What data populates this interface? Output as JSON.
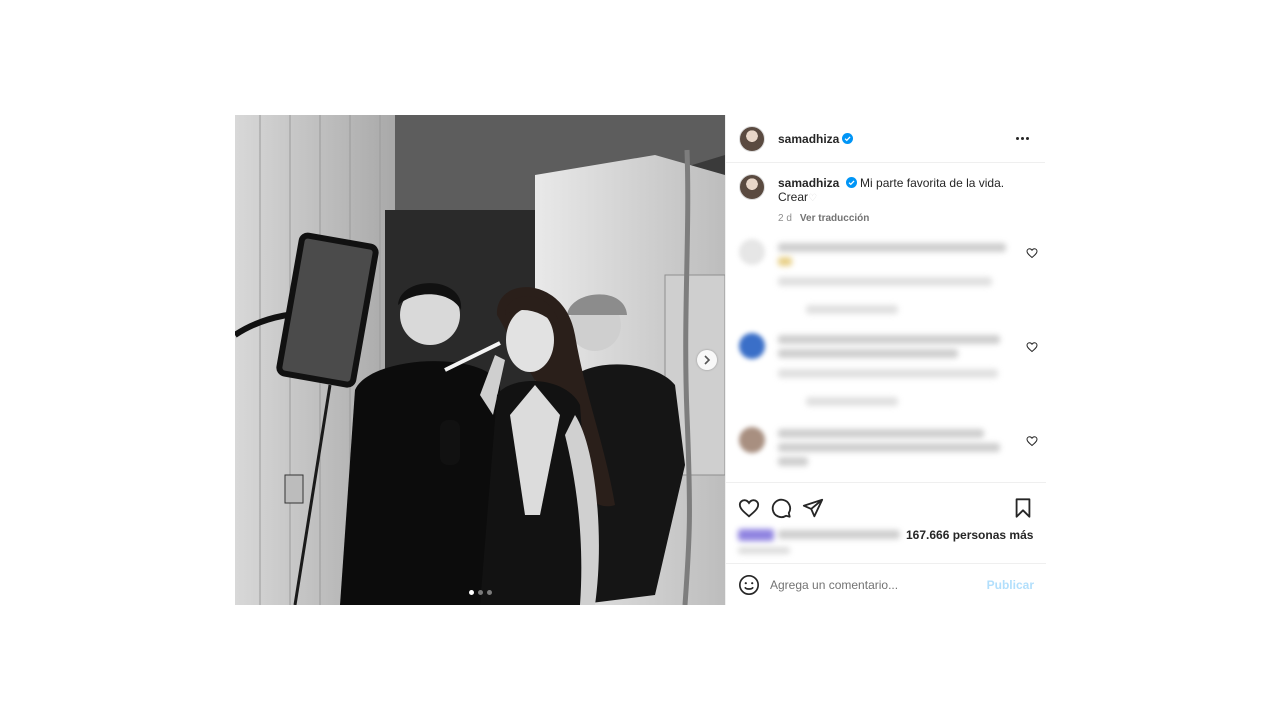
{
  "post": {
    "username": "samadhiza",
    "caption_text": "Mi parte favorita de la vida.",
    "caption_line2": "Crear",
    "time_ago": "2 d",
    "translate_label": "Ver traducción",
    "likes_suffix": "167.666 personas más",
    "comment_placeholder": "Agrega un comentario...",
    "publish_label": "Publicar"
  },
  "carousel": {
    "total": 3,
    "current": 1
  },
  "colors": {
    "verified": "#0095f6",
    "publish_disabled": "#b2dffc"
  },
  "icons": [
    "verified-badge-icon",
    "more-options-icon",
    "heart-icon",
    "comment-icon",
    "share-icon",
    "bookmark-icon",
    "emoji-icon",
    "chevron-right-icon"
  ]
}
